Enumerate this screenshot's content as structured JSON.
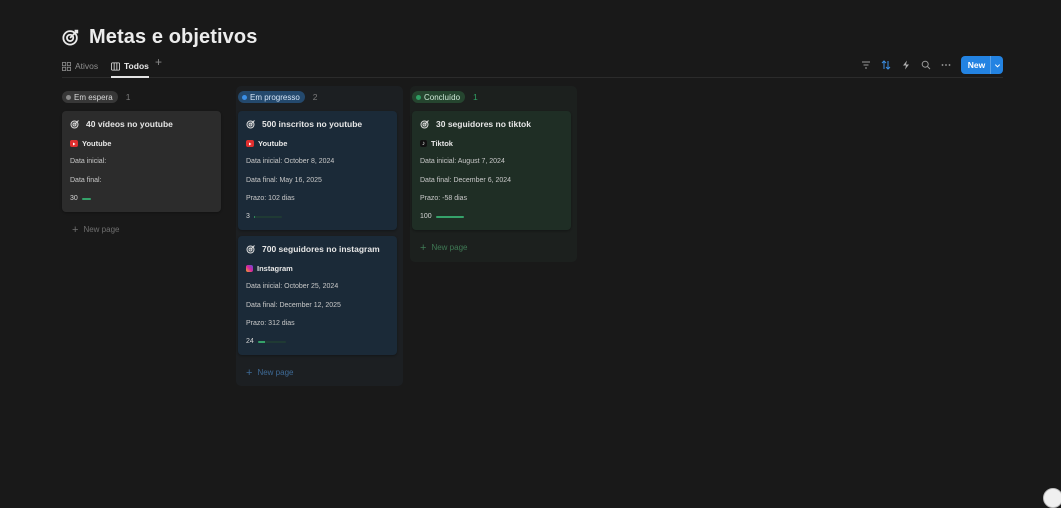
{
  "page": {
    "title": "Metas e objetivos"
  },
  "tabs": [
    {
      "label": "Ativos",
      "active": false
    },
    {
      "label": "Todos",
      "active": true
    }
  ],
  "toolbar": {
    "new_label": "New"
  },
  "columns": [
    {
      "status": "Em espera",
      "count": "1",
      "color": "#8a8a8a",
      "new_page": "New page",
      "cards": [
        {
          "title": "40 vídeos no youtube",
          "platform": "Youtube",
          "platform_icon": "youtube-icon",
          "data_inicial": "Data inicial:",
          "data_final": "Data final:",
          "prazo": "",
          "progress": "30",
          "progress_fraction": 0.3
        }
      ]
    },
    {
      "status": "Em progresso",
      "count": "2",
      "color": "#2f6fd1",
      "new_page": "New page",
      "cards": [
        {
          "title": "500 inscritos no youtube",
          "platform": "Youtube",
          "platform_icon": "youtube-icon",
          "data_inicial": "Data inicial: October 8, 2024",
          "data_final": "Data final: May 16, 2025",
          "prazo": "Prazo: 102 dias",
          "progress": "3",
          "progress_fraction": 0.03
        },
        {
          "title": "700 seguidores no instagram",
          "platform": "Instagram",
          "platform_icon": "instagram-icon",
          "data_inicial": "Data inicial: October 25, 2024",
          "data_final": "Data final: December 12, 2025",
          "prazo": "Prazo: 312 dias",
          "progress": "24",
          "progress_fraction": 0.24
        }
      ]
    },
    {
      "status": "Concluído",
      "count": "1",
      "color": "#2f9e63",
      "new_page": "New page",
      "cards": [
        {
          "title": "30 seguidores no tiktok",
          "platform": "Tiktok",
          "platform_icon": "tiktok-icon",
          "data_inicial": "Data inicial: August 7, 2024",
          "data_final": "Data final: December 6, 2024",
          "prazo": "Prazo: -58 dias",
          "progress": "100",
          "progress_fraction": 1.0
        }
      ]
    }
  ]
}
